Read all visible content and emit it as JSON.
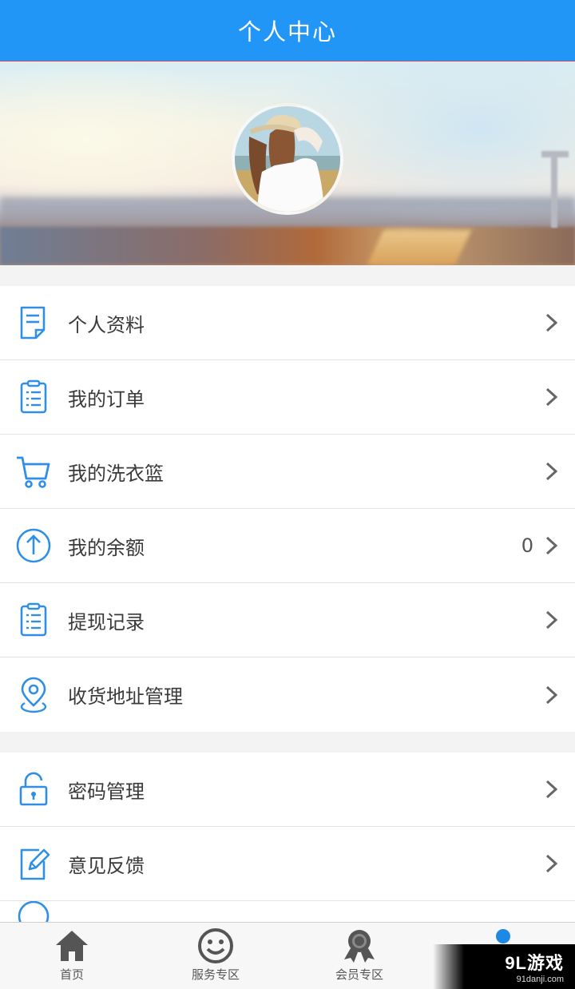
{
  "header": {
    "title": "个人中心"
  },
  "colors": {
    "accent": "#2196f7",
    "icon_blue": "#2f8fe6"
  },
  "menu_group_1": [
    {
      "label": "个人资料",
      "icon": "profile-doc-icon",
      "value": ""
    },
    {
      "label": "我的订单",
      "icon": "order-list-icon",
      "value": ""
    },
    {
      "label": "我的洗衣篮",
      "icon": "shopping-cart-icon",
      "value": ""
    },
    {
      "label": "我的余额",
      "icon": "balance-up-arrow-icon",
      "value": "0"
    },
    {
      "label": "提现记录",
      "icon": "withdraw-record-icon",
      "value": ""
    },
    {
      "label": "收货地址管理",
      "icon": "location-pin-icon",
      "value": ""
    }
  ],
  "menu_group_2": [
    {
      "label": "密码管理",
      "icon": "lock-icon",
      "value": ""
    },
    {
      "label": "意见反馈",
      "icon": "edit-feedback-icon",
      "value": ""
    }
  ],
  "tabbar": [
    {
      "label": "首页",
      "icon": "home-icon"
    },
    {
      "label": "服务专区",
      "icon": "smiley-icon"
    },
    {
      "label": "会员专区",
      "icon": "member-badge-icon"
    },
    {
      "label": "",
      "icon": "active-dot"
    }
  ],
  "watermark": {
    "main": "9L游戏",
    "sub": "91danji.com"
  }
}
